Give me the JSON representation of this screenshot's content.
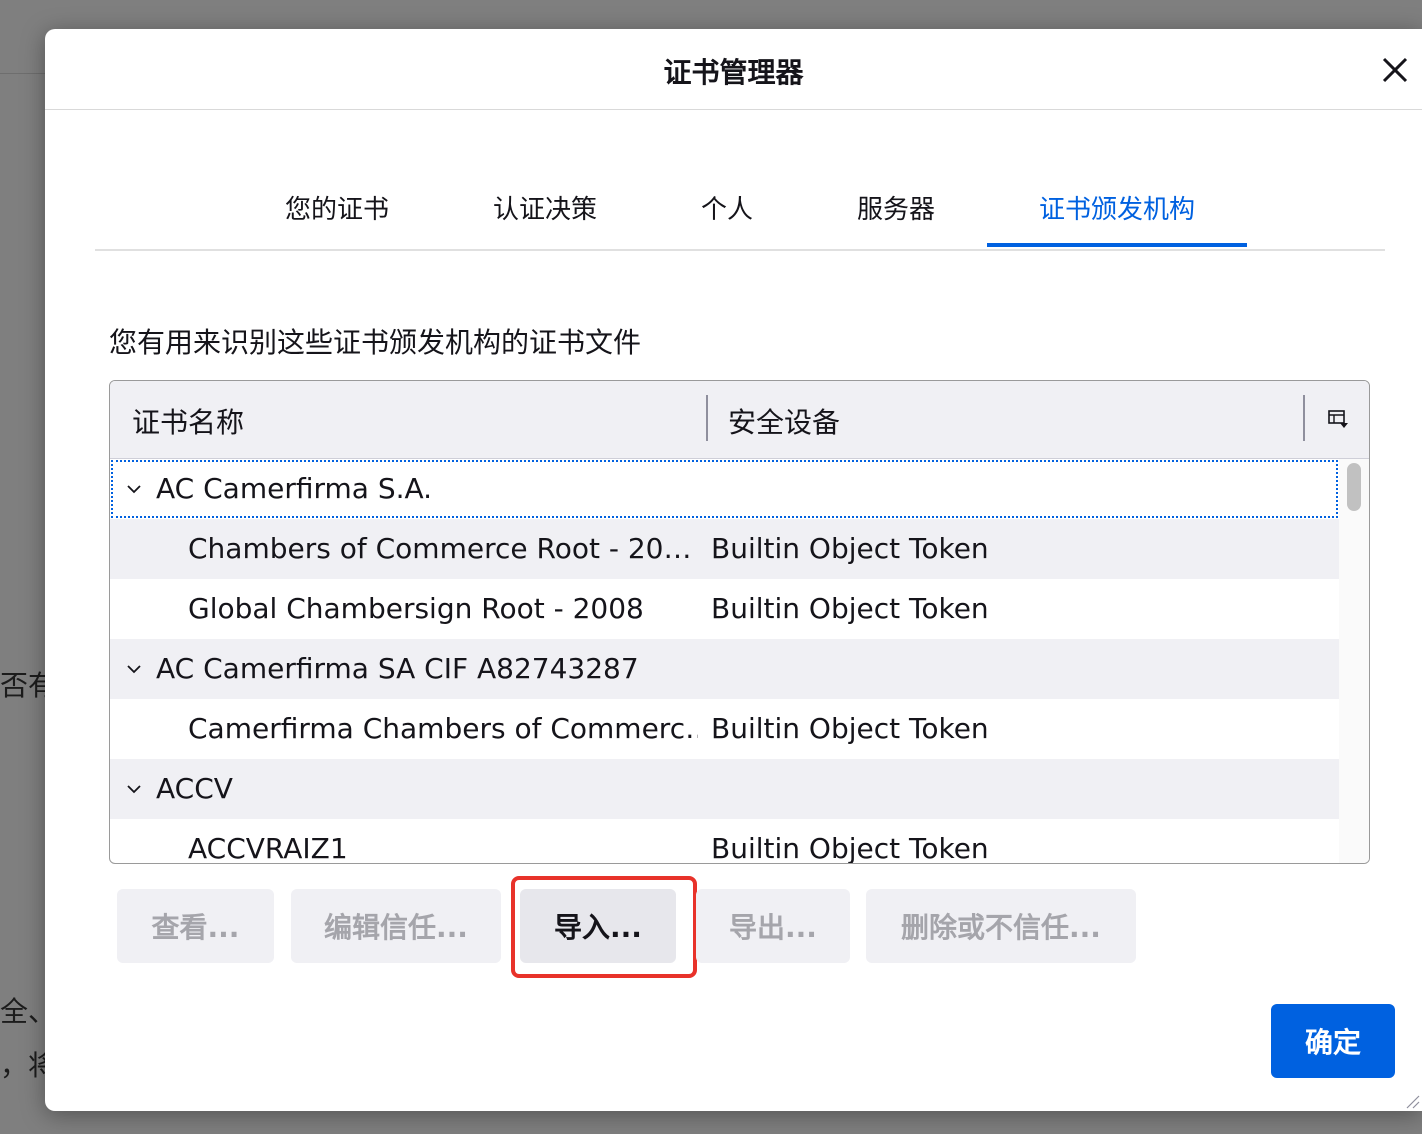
{
  "background": {
    "fragments": [
      "否有效",
      "全、",
      "，将"
    ]
  },
  "dialog": {
    "title": "证书管理器",
    "close_icon": "close-icon"
  },
  "tabs": [
    {
      "label": "您的证书",
      "active": false
    },
    {
      "label": "认证决策",
      "active": false
    },
    {
      "label": "个人",
      "active": false
    },
    {
      "label": "服务器",
      "active": false
    },
    {
      "label": "证书颁发机构",
      "active": true
    }
  ],
  "description": "您有用来识别这些证书颁发机构的证书文件",
  "tree": {
    "columns": [
      "证书名称",
      "安全设备"
    ],
    "column_picker_icon": "column-picker-icon",
    "rows": [
      {
        "type": "group",
        "name": "AC Camerfirma S.A.",
        "device": "",
        "expanded": true,
        "focused": true
      },
      {
        "type": "cert",
        "name": "Chambers of Commerce Root - 20…",
        "device": "Builtin Object Token"
      },
      {
        "type": "cert",
        "name": "Global Chambersign Root - 2008",
        "device": "Builtin Object Token"
      },
      {
        "type": "group",
        "name": "AC Camerfirma SA CIF A82743287",
        "device": "",
        "expanded": true
      },
      {
        "type": "cert",
        "name": "Camerfirma Chambers of Commerc…",
        "device": "Builtin Object Token"
      },
      {
        "type": "group",
        "name": "ACCV",
        "device": "",
        "expanded": true
      },
      {
        "type": "cert",
        "name": "ACCVRAIZ1",
        "device": "Builtin Object Token"
      }
    ]
  },
  "buttons": {
    "view": "查看...",
    "edit_trust": "编辑信任...",
    "import": "导入...",
    "export": "导出...",
    "delete": "删除或不信任...",
    "ok": "确定"
  },
  "colors": {
    "accent": "#0061e0",
    "highlight": "#e8322a"
  }
}
